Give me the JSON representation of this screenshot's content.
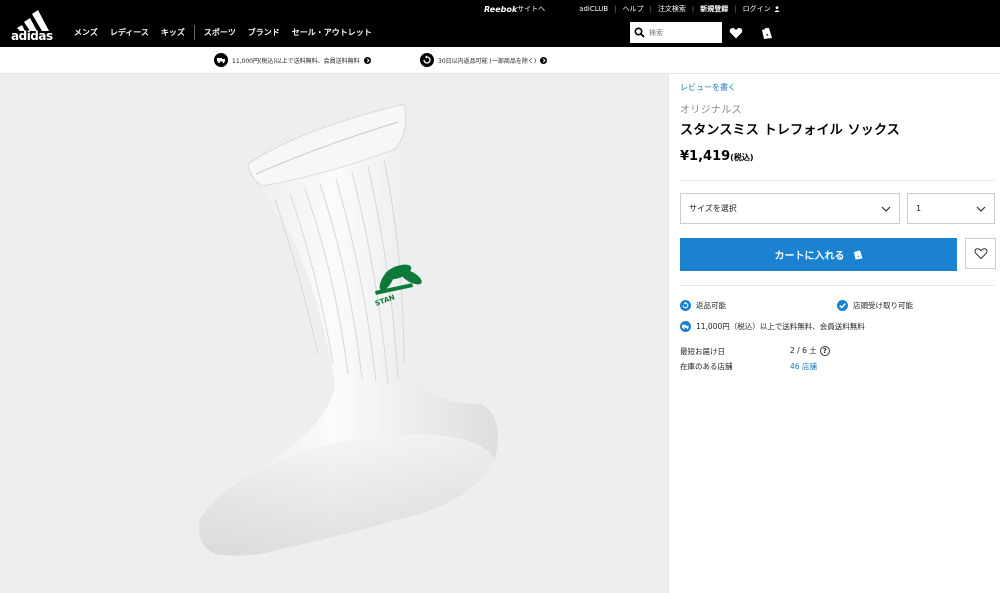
{
  "topbar": {
    "reebok": "Reebok",
    "reebok_suffix": "サイトへ",
    "adiclub": "adiCLUB",
    "help": "ヘルプ",
    "order_search": "注文検索",
    "register": "新規登録",
    "login": "ログイン"
  },
  "nav": {
    "logo": "adidas",
    "items": [
      "メンズ",
      "レディース",
      "キッズ",
      "スポーツ",
      "ブランド",
      "セール・アウトレット"
    ],
    "search_placeholder": "検索"
  },
  "promo": {
    "shipping": "11,000円(税込)以上で送料無料、会員送料無料",
    "returns": "30日以内返品可能 (一部商品を除く)"
  },
  "product": {
    "review_link": "レビューを書く",
    "brand": "オリジナルス",
    "name": "スタンスミス トレフォイル ソックス",
    "price": "¥1,419",
    "tax_note": "(税込)",
    "size_placeholder": "サイズを選択",
    "quantity": "1",
    "add_to_cart": "カートに入れる",
    "feature_returns": "返品可能",
    "feature_pickup": "店頭受け取り可能",
    "feature_shipping": "11,000円（税込）以上で送料無料、会員送料無料",
    "delivery_label": "最短お届け日",
    "delivery_value": "2 / 6 土",
    "stock_label": "在庫のある店舗",
    "stock_value": "46 店舗"
  },
  "colors": {
    "accent_blue": "#1a82d0",
    "link_blue": "#1a78c2",
    "logo_green": "#0e7a3a"
  }
}
